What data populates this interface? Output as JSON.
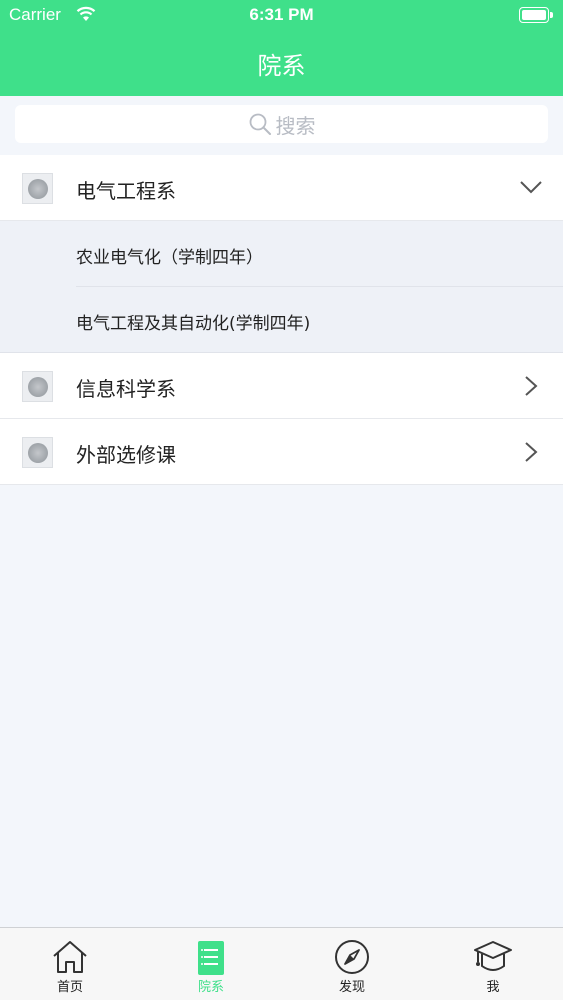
{
  "status_bar": {
    "carrier": "Carrier",
    "time": "6:31 PM"
  },
  "header": {
    "title": "院系"
  },
  "search": {
    "placeholder": "搜索"
  },
  "departments": [
    {
      "name": "电气工程系",
      "expanded": true,
      "majors": [
        "农业电气化（学制四年）",
        "电气工程及其自动化(学制四年)"
      ]
    },
    {
      "name": "信息科学系",
      "expanded": false
    },
    {
      "name": "外部选修课",
      "expanded": false
    }
  ],
  "tabbar": {
    "items": [
      {
        "label": "首页",
        "icon": "home-icon"
      },
      {
        "label": "院系",
        "icon": "list-icon",
        "active": true
      },
      {
        "label": "发现",
        "icon": "compass-icon"
      },
      {
        "label": "我",
        "icon": "graduation-cap-icon"
      }
    ]
  },
  "colors": {
    "accent": "#3fe08a",
    "background": "#f3f6fb"
  }
}
